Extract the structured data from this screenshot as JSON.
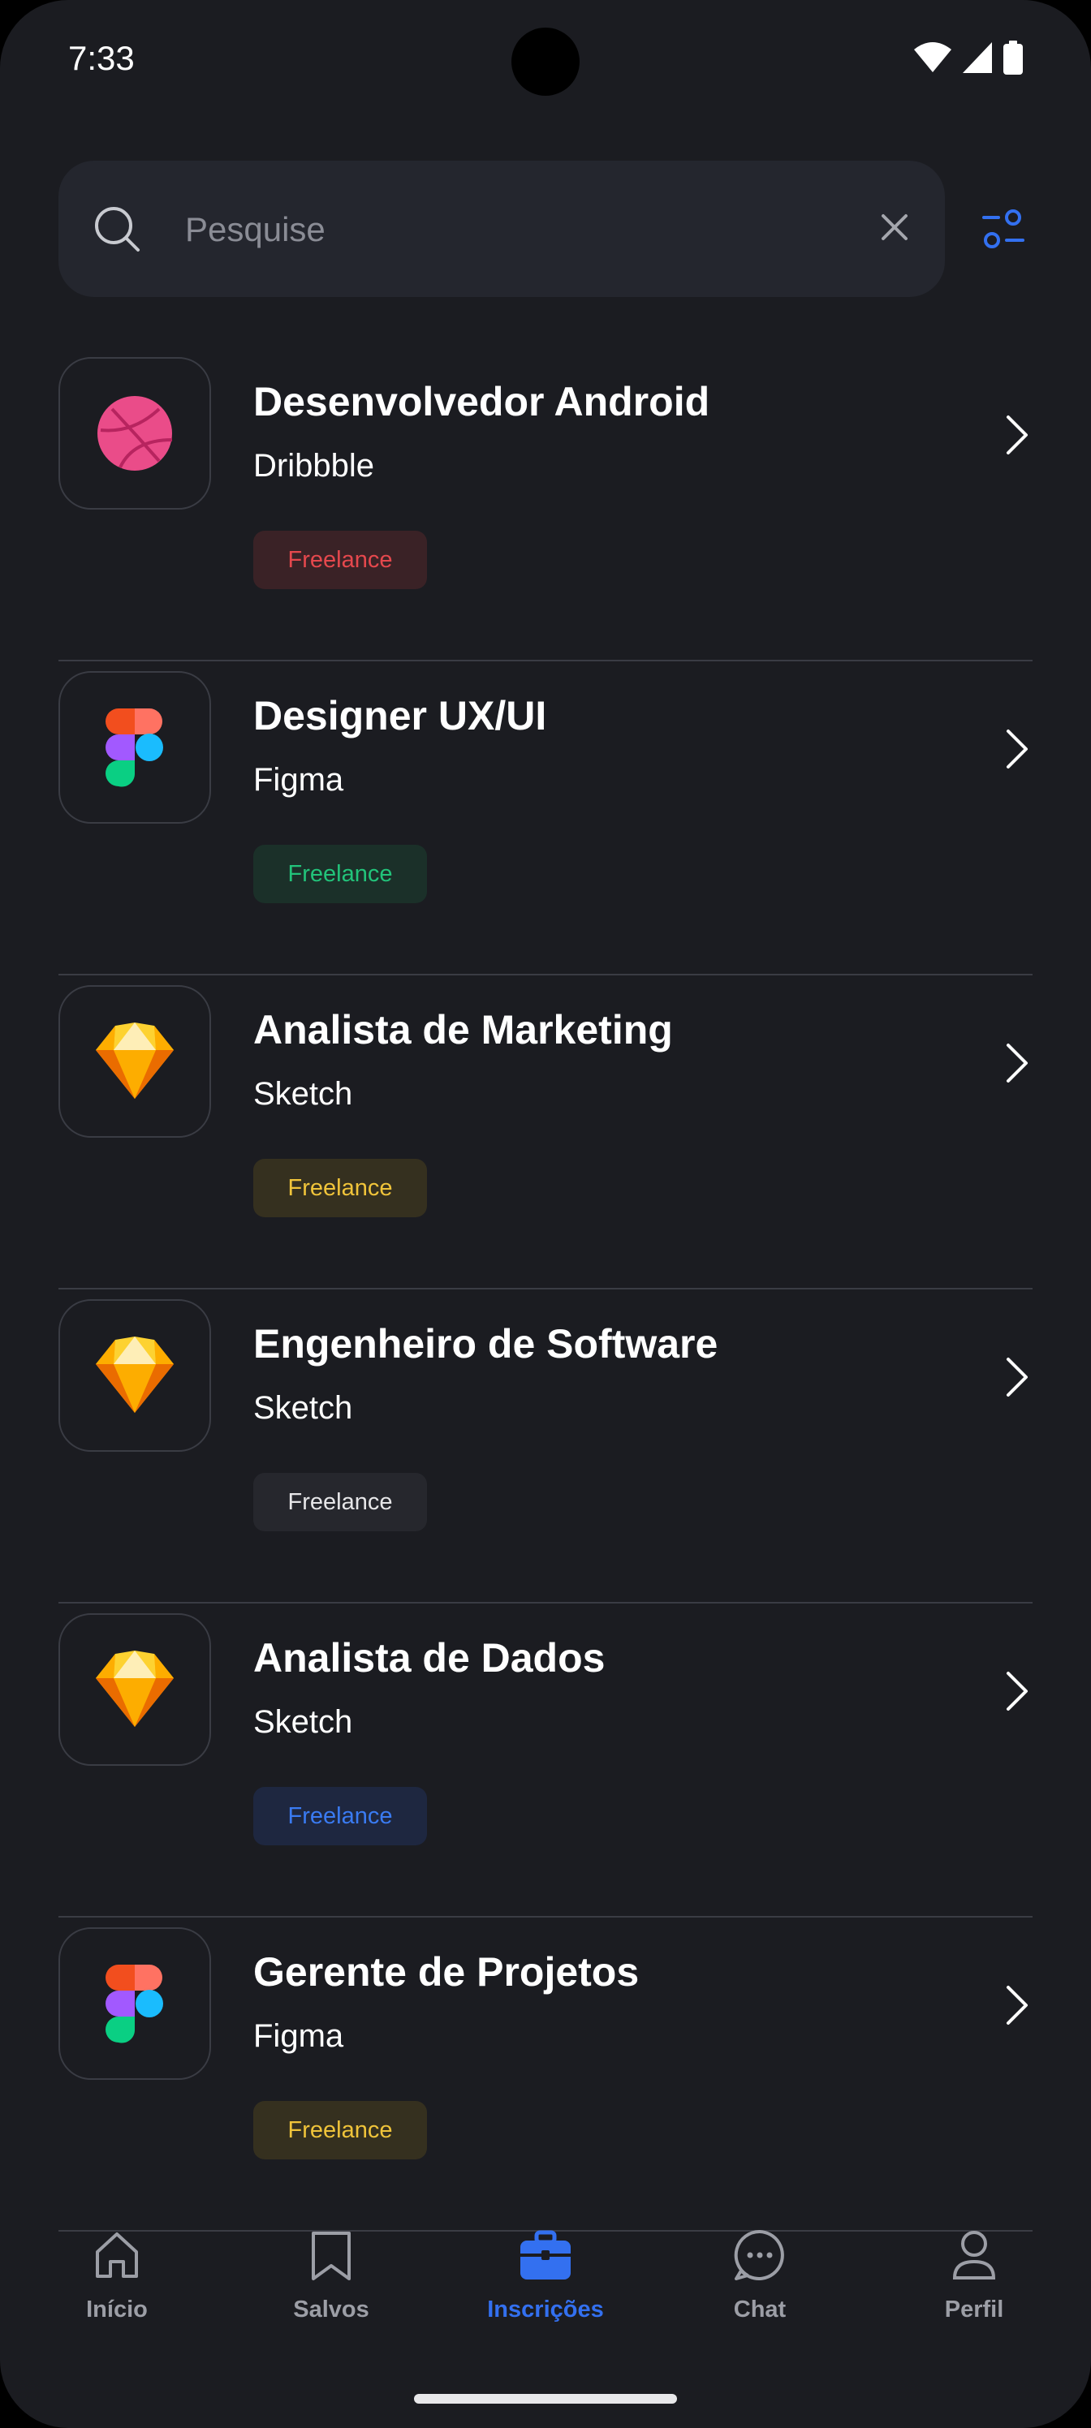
{
  "status_bar": {
    "time": "7:33"
  },
  "search": {
    "placeholder": "Pesquise",
    "value": ""
  },
  "jobs": [
    {
      "title": "Desenvolvedor Android",
      "company": "Dribbble",
      "tag": "Freelance",
      "logo": "dribbble-logo",
      "tag_color": "#e5484d",
      "tag_bg": "#3a2226"
    },
    {
      "title": "Designer UX/UI",
      "company": "Figma",
      "tag": "Freelance",
      "logo": "figma-logo",
      "tag_color": "#22c37a",
      "tag_bg": "#1b3029"
    },
    {
      "title": "Analista de Marketing",
      "company": "Sketch",
      "tag": "Freelance",
      "logo": "sketch-logo",
      "tag_color": "#f0c43a",
      "tag_bg": "#35301f"
    },
    {
      "title": "Engenheiro de Software",
      "company": "Sketch",
      "tag": "Freelance",
      "logo": "sketch-logo",
      "tag_color": "#e6e6e8",
      "tag_bg": "#26272d"
    },
    {
      "title": "Analista de Dados",
      "company": "Sketch",
      "tag": "Freelance",
      "logo": "sketch-logo",
      "tag_color": "#3a7bf2",
      "tag_bg": "#1e2740"
    },
    {
      "title": "Gerente de Projetos",
      "company": "Figma",
      "tag": "Freelance",
      "logo": "figma-logo",
      "tag_color": "#f0c43a",
      "tag_bg": "#35301f"
    }
  ],
  "nav": {
    "items": [
      {
        "label": "Início",
        "icon": "home-icon"
      },
      {
        "label": "Salvos",
        "icon": "bookmark-icon"
      },
      {
        "label": "Inscrições",
        "icon": "briefcase-icon"
      },
      {
        "label": "Chat",
        "icon": "chat-icon"
      },
      {
        "label": "Perfil",
        "icon": "profile-icon"
      }
    ],
    "active_index": 2
  },
  "colors": {
    "background": "#1b1c21",
    "accent": "#3370f0",
    "surface": "#24262e"
  }
}
